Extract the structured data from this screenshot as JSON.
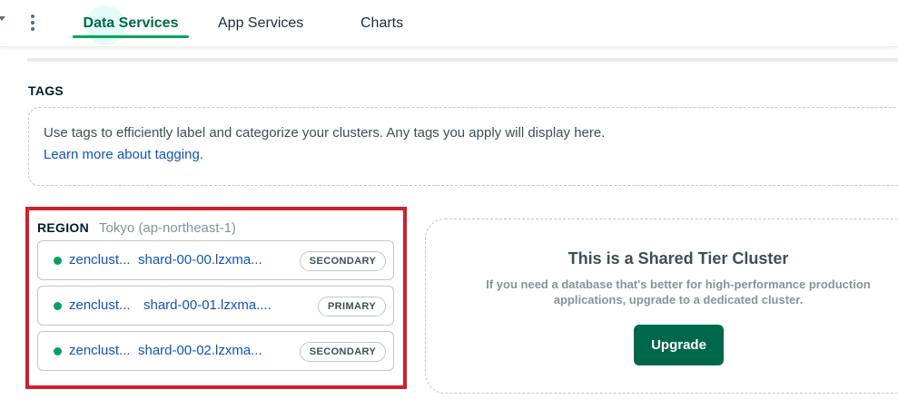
{
  "nav": {
    "tabs": [
      {
        "label": "Data Services",
        "active": true
      },
      {
        "label": "App Services",
        "active": false
      },
      {
        "label": "Charts",
        "active": false
      }
    ]
  },
  "tags": {
    "heading": "TAGS",
    "description": "Use tags to efficiently label and categorize your clusters. Any tags you apply will display here.",
    "link": "Learn more about tagging."
  },
  "region": {
    "heading": "REGION",
    "name": "Tokyo (ap-northeast-1)",
    "hosts": [
      {
        "name_start": "zenclust...",
        "name_end": "shard-00-00.lzxma...",
        "role": "SECONDARY",
        "status": "online"
      },
      {
        "name_start": "zenclust...",
        "name_end": "shard-00-01.lzxma....",
        "role": "PRIMARY",
        "status": "online"
      },
      {
        "name_start": "zenclust...",
        "name_end": "shard-00-02.lzxma...",
        "role": "SECONDARY",
        "status": "online"
      }
    ]
  },
  "tier": {
    "title": "This is a Shared Tier Cluster",
    "description": "If you need a database that's better for high-performance production applications, upgrade to a dedicated cluster.",
    "button": "Upgrade"
  },
  "colors": {
    "brand_green": "#00684a",
    "active_tab": "#00a35c",
    "link": "#1254b7",
    "status_online": "#00a35c",
    "highlight_border": "#d0202e"
  }
}
